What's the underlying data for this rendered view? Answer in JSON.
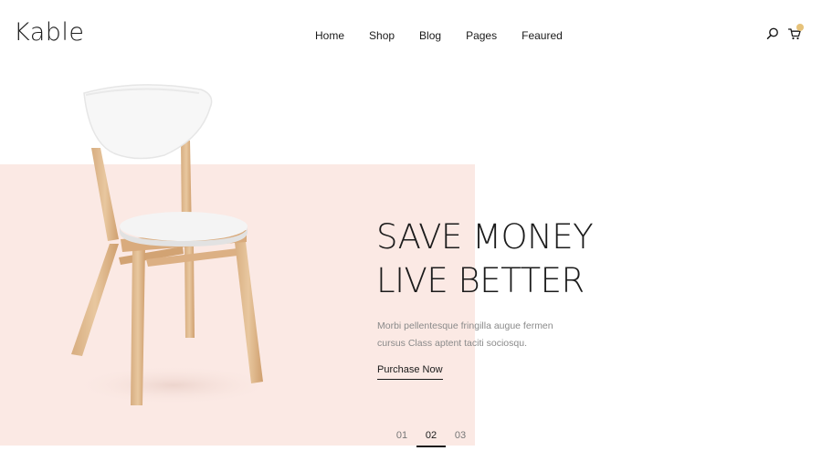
{
  "brand": {
    "logo_text": "Kable"
  },
  "nav": {
    "items": [
      {
        "label": "Home"
      },
      {
        "label": "Shop"
      },
      {
        "label": "Blog"
      },
      {
        "label": "Pages"
      },
      {
        "label": "Feaured"
      }
    ]
  },
  "header_actions": {
    "search_icon": "search-icon",
    "cart_icon": "cart-icon",
    "cart_badge_color": "#e6c27a"
  },
  "hero": {
    "title_line1": "SAVE MONEY",
    "title_line2": "LIVE BETTER",
    "desc_line1": "Morbi pellentesque fringilla augue fermen",
    "desc_line2": "cursus Class aptent taciti sociosqu.",
    "cta_label": "Purchase Now",
    "background_color": "#fbe9e4"
  },
  "slider": {
    "pages": [
      "01",
      "02",
      "03"
    ],
    "active": "02"
  }
}
